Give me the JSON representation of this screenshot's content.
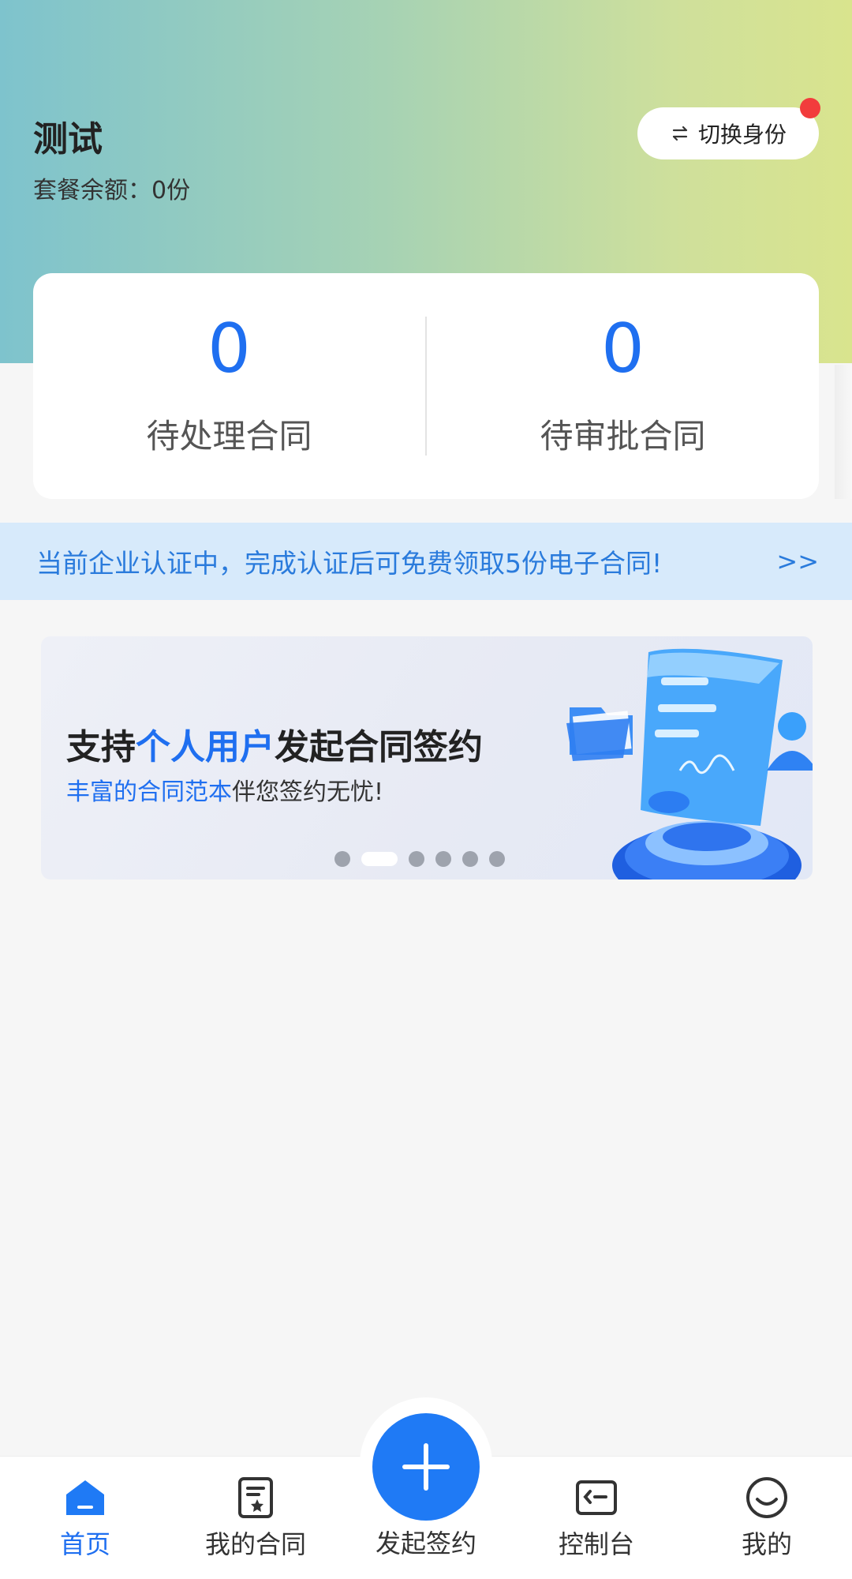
{
  "header": {
    "user_name": "测试",
    "balance_label": "套餐余额：",
    "balance_value": "0份",
    "switch_identity": "切换身份"
  },
  "stats": [
    {
      "value": "0",
      "label": "待处理合同"
    },
    {
      "value": "0",
      "label": "待审批合同"
    }
  ],
  "notice": {
    "text": "当前企业认证中，完成认证后可免费领取5份电子合同!",
    "more": ">>"
  },
  "banner": {
    "title_prefix": "支持",
    "title_highlight": "个人用户",
    "title_suffix": "发起合同签约",
    "subtitle_highlight": "丰富的合同范本",
    "subtitle_rest": "伴您签约无忧!",
    "carousel_count": 6,
    "carousel_active_index": 1
  },
  "bottom_nav": {
    "items": [
      {
        "label": "首页",
        "icon": "home-icon",
        "active": true
      },
      {
        "label": "我的合同",
        "icon": "contract-icon",
        "active": false
      },
      {
        "label": "发起签约",
        "icon": "plus-icon",
        "active": false
      },
      {
        "label": "控制台",
        "icon": "console-icon",
        "active": false
      },
      {
        "label": "我的",
        "icon": "smile-icon",
        "active": false
      }
    ]
  },
  "colors": {
    "accent": "#1f6ff0",
    "badge": "#f23c3c",
    "notice_bg": "#d7eafb"
  }
}
